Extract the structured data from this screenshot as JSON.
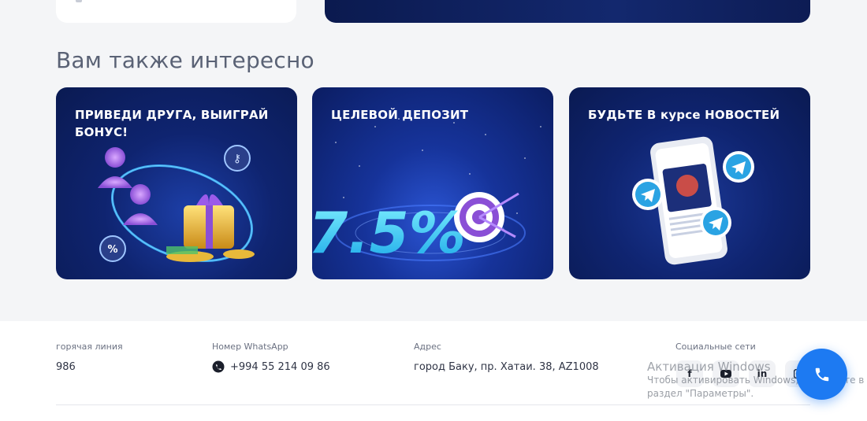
{
  "section": {
    "title": "Вам также интересно"
  },
  "cards": [
    {
      "title": "ПРИВЕДИ ДРУГА, ВЫИГРАЙ БОНУС!"
    },
    {
      "title": "ЦЕЛЕВОЙ ДЕПОЗИТ",
      "promo_value": "7.5%"
    },
    {
      "title": "БУДЬТЕ В курсе НОВОСТЕЙ"
    }
  ],
  "footer": {
    "hotline": {
      "label": "горячая линия",
      "value": "986"
    },
    "whatsapp": {
      "label": "Номер WhatsApp",
      "value": "+994 55 214 09 86"
    },
    "address": {
      "label": "Адрес",
      "value": "город Баку, пр. Хатаи. 38, AZ1008"
    },
    "social": {
      "label": "Социальные сети",
      "icons": [
        "facebook-icon",
        "youtube-icon",
        "linkedin-icon",
        "instagram-icon"
      ]
    }
  },
  "windows_watermark": {
    "title": "Активация Windows",
    "line1": "Чтобы активировать Windows, перейдите в",
    "line2": "раздел \"Параметры\"."
  },
  "colors": {
    "accent": "#1d7af2",
    "card_bg": "#0f2470",
    "page_bg": "#f4f5f7"
  }
}
